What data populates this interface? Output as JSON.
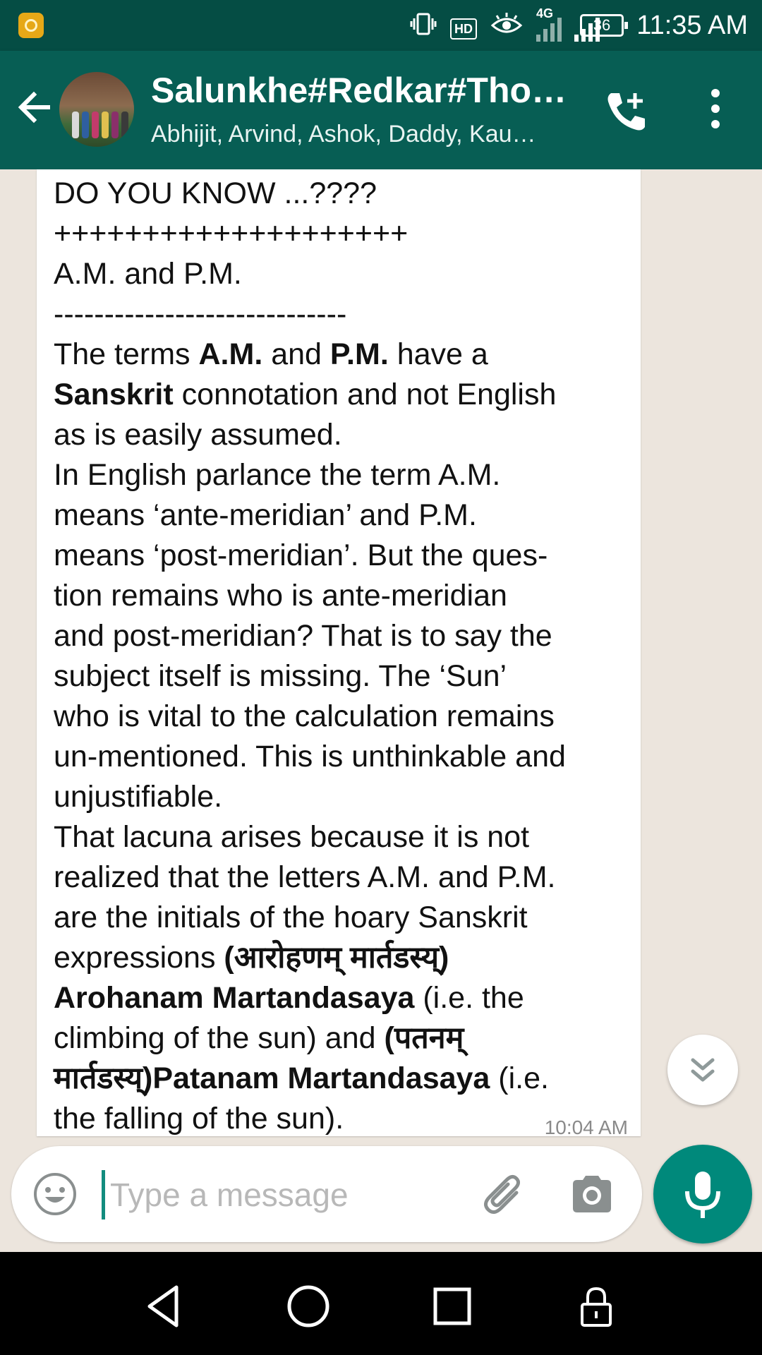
{
  "status_bar": {
    "time": "11:35 AM",
    "battery": "36",
    "hd_label": "HD",
    "network_label": "4G",
    "icons": [
      "app-notification-icon",
      "vibrate-icon",
      "hd-icon",
      "eye-icon",
      "signal-4g-icon",
      "signal-icon",
      "battery-icon"
    ]
  },
  "header": {
    "title": "Salunkhe#Redkar#Tho…",
    "subtitle": "Abhijit, Arvind, Ashok, Daddy, Kau…",
    "icons": [
      "back-arrow-icon",
      "group-avatar",
      "add-call-icon",
      "more-vert-icon"
    ]
  },
  "message": {
    "time": "10:04 AM",
    "line01": "DO YOU KNOW ...????",
    "line02": "++++++++++++++++++++",
    "line03": "A.M. and P.M.",
    "line04": "-----------------------------",
    "l05a": "The terms ",
    "l05b": "A.M.",
    "l05c": " and ",
    "l05d": "P.M.",
    "l05e": " have a",
    "l06a": "Sanskrit",
    "l06b": " connotation and not English",
    "line07": "as is easily assumed.",
    "line08": "In English parlance the term A.M.",
    "line09": "means ‘ante-meridian’ and P.M.",
    "line10": "means ‘post-meridian’. But the ques-",
    "line11": "tion remains who is ante-meridian",
    "line12": "and post-meridian? That is to say the",
    "line13": "subject itself is missing. The ‘Sun’",
    "line14": "who is vital to the calculation remains",
    "line15": "un-mentioned. This is unthinkable and",
    "line16": "unjustifiable.",
    "line17": "That lacuna arises because it is not",
    "line18": "realized that the letters A.M. and P.M.",
    "line19": "are the initials of the hoary Sanskrit",
    "l20a": "expressions ",
    "l20b": "(आरोहणम् मार्तडस्य्)",
    "l21a": "Arohanam Martandasaya",
    "l21b": " (i.e. the",
    "l22a": "climbing of the sun) and ",
    "l22b": "(पतनम्",
    "l23a": "मार्तडस्य्)Patanam Martandasaya",
    "l23b": " (i.e.",
    "line24": "the falling of the sun)."
  },
  "composer": {
    "placeholder": "Type a message",
    "value": "",
    "icons": [
      "emoji-icon",
      "attach-icon",
      "camera-icon",
      "mic-icon"
    ]
  },
  "nav_bar": {
    "icons": [
      "nav-back-icon",
      "nav-home-icon",
      "nav-recents-icon",
      "nav-lock-icon"
    ]
  },
  "colors": {
    "header": "#075e54",
    "status_bar": "#054d44",
    "accent": "#00897b",
    "chat_background": "#ece5dd",
    "bubble": "#ffffff"
  }
}
